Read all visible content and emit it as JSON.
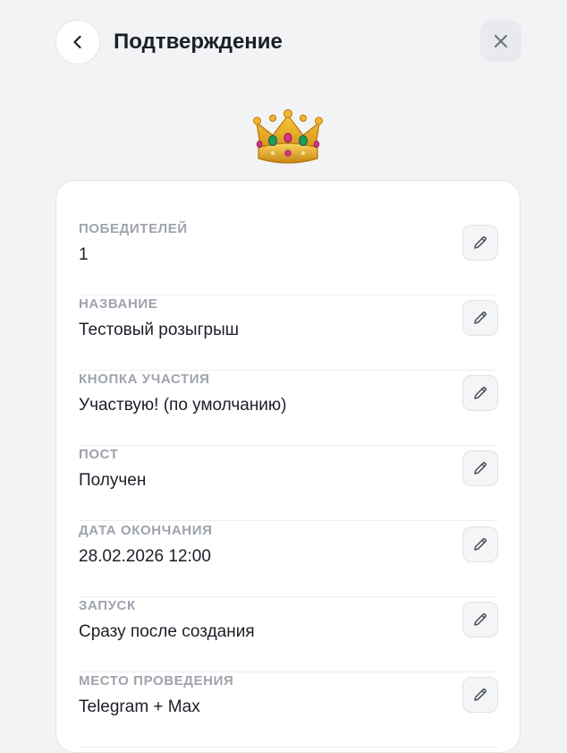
{
  "header": {
    "title": "Подтверждение"
  },
  "icons": {
    "back": "chevron-left-icon",
    "close": "close-icon",
    "hero": "crown-emoji",
    "edit": "pencil-icon"
  },
  "fields": [
    {
      "label": "ПОБЕДИТЕЛЕЙ",
      "value": "1"
    },
    {
      "label": "НАЗВАНИЕ",
      "value": "Тестовый розыгрыш"
    },
    {
      "label": "КНОПКА УЧАСТИЯ",
      "value": "Участвую! (по умолчанию)"
    },
    {
      "label": "ПОСТ",
      "value": "Получен"
    },
    {
      "label": "ДАТА ОКОНЧАНИЯ",
      "value": "28.02.2026 12:00"
    },
    {
      "label": "ЗАПУСК",
      "value": "Сразу после создания"
    },
    {
      "label": "МЕСТО ПРОВЕДЕНИЯ",
      "value": "Telegram + Max"
    }
  ]
}
